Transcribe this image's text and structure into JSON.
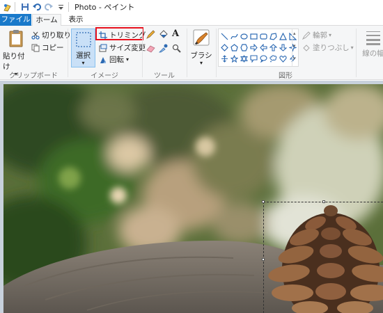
{
  "window": {
    "title": "Photo - ペイント"
  },
  "tabs": {
    "file": "ファイル",
    "home": "ホーム",
    "view": "表示"
  },
  "clipboard": {
    "paste": "貼り付け",
    "cut": "切り取り",
    "copy": "コピー",
    "label": "クリップボード"
  },
  "image": {
    "select": "選択",
    "crop": "トリミング",
    "resize": "サイズ変更",
    "rotate": "回転",
    "label": "イメージ"
  },
  "tools": {
    "label": "ツール",
    "text_glyph": "A"
  },
  "brush": {
    "label": "ブラシ"
  },
  "shapes": {
    "label": "図形",
    "outline": "輪郭",
    "fill": "塗りつぶし"
  },
  "size": {
    "label": "線の幅"
  },
  "colors": {
    "accent": "#1979ca",
    "highlight": "#e8121e",
    "selected_bg": "#c9e0f7"
  }
}
